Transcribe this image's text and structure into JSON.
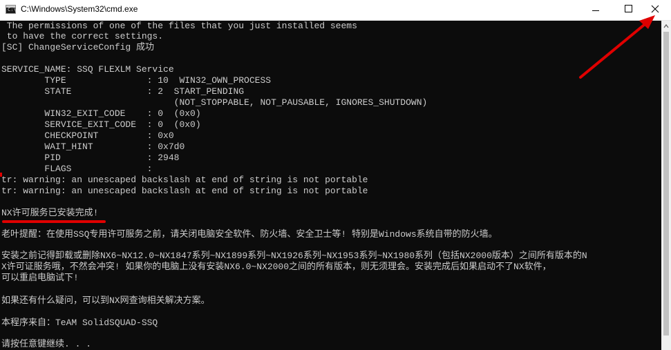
{
  "window": {
    "title": "C:\\Windows\\System32\\cmd.exe",
    "icon": "cmd-icon",
    "icon_prompt_text": "C:\\"
  },
  "controls": {
    "minimize_icon": "minimize-icon",
    "maximize_icon": "maximize-icon",
    "close_icon": "close-icon"
  },
  "console": {
    "lines": [
      " The permissions of one of the files that you just installed seems",
      " to have the correct settings.",
      "[SC] ChangeServiceConfig 成功",
      "",
      "SERVICE_NAME: SSQ FLEXLM Service",
      "        TYPE               : 10  WIN32_OWN_PROCESS",
      "        STATE              : 2  START_PENDING",
      "                                (NOT_STOPPABLE, NOT_PAUSABLE, IGNORES_SHUTDOWN)",
      "        WIN32_EXIT_CODE    : 0  (0x0)",
      "        SERVICE_EXIT_CODE  : 0  (0x0)",
      "        CHECKPOINT         : 0x0",
      "        WAIT_HINT          : 0x7d0",
      "        PID                : 2948",
      "        FLAGS              :",
      "tr: warning: an unescaped backslash at end of string is not portable",
      "tr: warning: an unescaped backslash at end of string is not portable",
      "",
      "NX许可服务已安装完成!",
      "",
      "老叶提醒：在使用SSQ专用许可服务之前，请关闭电脑安全软件、防火墙、安全卫士等! 特别是Windows系统自带的防火墙。",
      "",
      "安装之前记得卸载或删除NX6~NX12.0~NX1847系列~NX1899系列~NX1926系列~NX1953系列~NX1980系列（包括NX2000版本）之间所有版本的N",
      "X许可证服务哦，不然会冲突! 如果你的电脑上没有安装NX6.0~NX2000之间的所有版本，则无须理会。安装完成后如果启动不了NX软件，",
      "可以重启电脑试下!",
      "",
      "如果还有什么疑问，可以到NX网查询相关解决方案。",
      "",
      "本程序来自：TeAM SolidSQUAD-SSQ",
      "",
      "请按任意键继续. . ."
    ]
  },
  "annotation": {
    "color": "#e00000"
  }
}
